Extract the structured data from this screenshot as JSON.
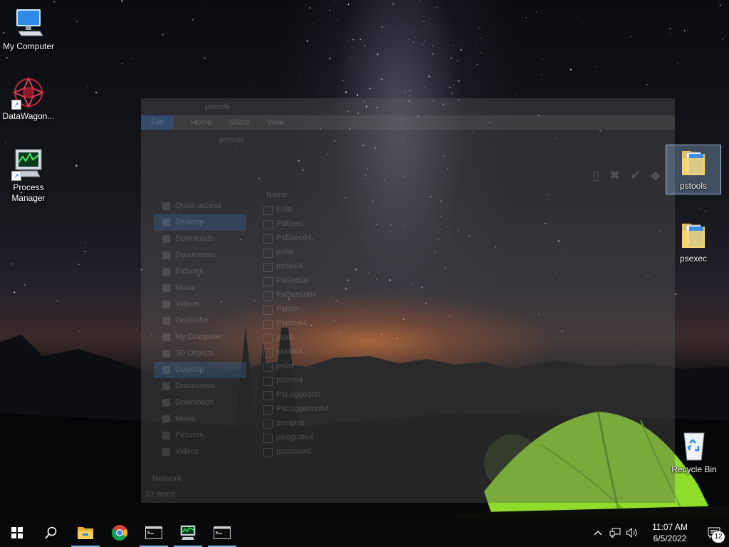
{
  "desktop": {
    "icons": [
      {
        "label": "My Computer"
      },
      {
        "label": "DataWagon..."
      },
      {
        "label": "Process Manager"
      },
      {
        "label": "pstools"
      },
      {
        "label": "psexec"
      },
      {
        "label": "Recycle Bin"
      }
    ]
  },
  "explorer": {
    "title": "pstools",
    "ribbon_tabs": [
      "File",
      "Home",
      "Share",
      "View"
    ],
    "address": "pstools",
    "nav": [
      "Quick access",
      "Desktop",
      "Downloads",
      "Documents",
      "Pictures",
      "Music",
      "Videos",
      "OneDrive",
      "My Computer",
      "3D Objects",
      "Desktop",
      "Documents",
      "Downloads",
      "Music",
      "Pictures",
      "Videos"
    ],
    "nav_footer": "Network",
    "column_header": "Name",
    "files": [
      {
        "name": "Eula"
      },
      {
        "name": "PsExec"
      },
      {
        "name": "PsExec64"
      },
      {
        "name": "psfile"
      },
      {
        "name": "psfile64"
      },
      {
        "name": "PsGetsid"
      },
      {
        "name": "PsGetsid64"
      },
      {
        "name": "PsInfo"
      },
      {
        "name": "PsInfo64"
      },
      {
        "name": "pskill"
      },
      {
        "name": "pskill64"
      },
      {
        "name": "pslist"
      },
      {
        "name": "pslist64"
      },
      {
        "name": "PsLoggedon"
      },
      {
        "name": "PsLoggedon64"
      },
      {
        "name": "psloglist"
      },
      {
        "name": "psloglist64"
      },
      {
        "name": "pspasswd"
      }
    ],
    "status": "23 items"
  },
  "taskbar": {
    "apps": [
      "start-icon",
      "search-icon",
      "file-explorer-icon",
      "chrome-icon",
      "terminal-icon",
      "process-manager-icon",
      "terminal-icon"
    ],
    "clock": {
      "time": "11:07 AM",
      "date": "6/5/2022"
    },
    "notification_count": "12"
  },
  "colors": {
    "taskbar": "#08080a",
    "selection": "#96b9e6",
    "accent_running": "#76b9ed",
    "tent_green": "#8fdc2a"
  }
}
